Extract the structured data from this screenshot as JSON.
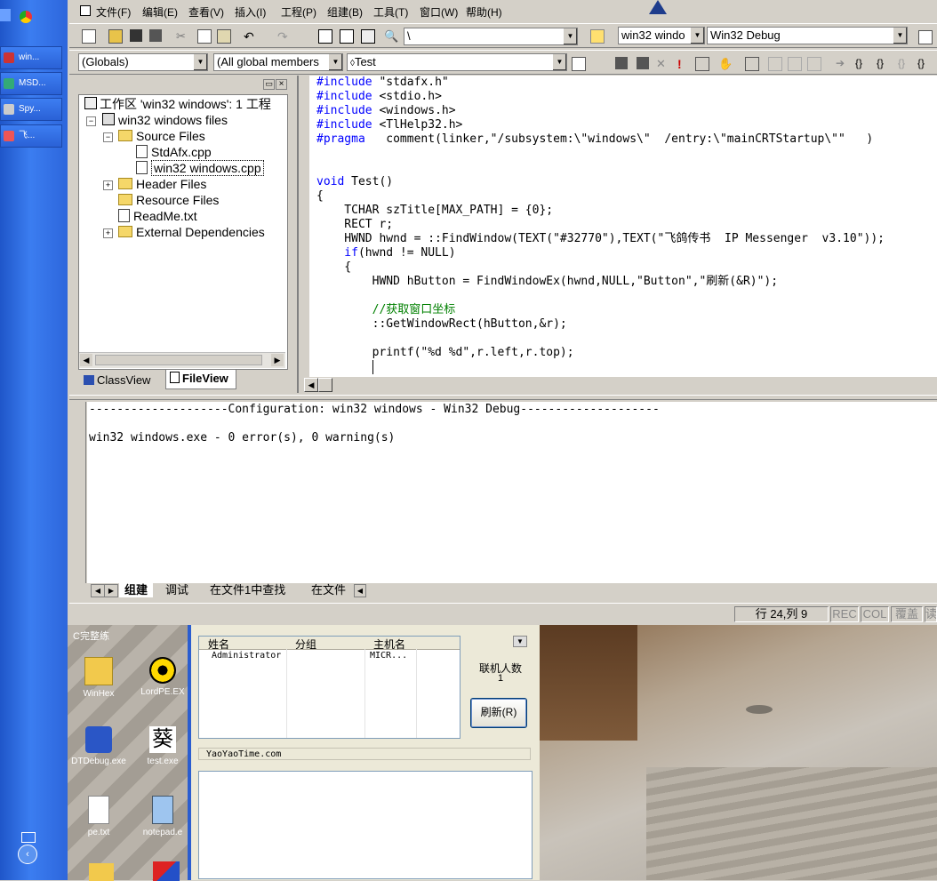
{
  "taskbar": {
    "items": [
      {
        "label": "win..."
      },
      {
        "label": "MSD..."
      },
      {
        "label": "Spy..."
      },
      {
        "label": "飞..."
      }
    ]
  },
  "menu": [
    "文件(F)",
    "编辑(E)",
    "查看(V)",
    "插入(I)",
    "工程(P)",
    "组建(B)",
    "工具(T)",
    "窗口(W)",
    "帮助(H)"
  ],
  "toolbar": {
    "find_value": "\\",
    "project_combo": "win32 windo",
    "config_combo": "Win32 Debug",
    "scope_combo": "(Globals)",
    "members_combo": "(All global members",
    "function_combo": "Test"
  },
  "workspace": {
    "title": "工作区 'win32 windows': 1 工程",
    "project": "win32 windows files",
    "source_folder": "Source Files",
    "file1": "StdAfx.cpp",
    "file2": "win32 windows.cpp",
    "header_folder": "Header Files",
    "resource_folder": "Resource Files",
    "readme": "ReadMe.txt",
    "external": "External Dependencies",
    "tab_classview": "ClassView",
    "tab_fileview": "FileView"
  },
  "code": [
    {
      "a": "#include",
      "b": " \"stdafx.h\""
    },
    {
      "a": "#include",
      "b": " <stdio.h>"
    },
    {
      "a": "#include",
      "b": " <windows.h>"
    },
    {
      "a": "#include",
      "b": " <TlHelp32.h>"
    },
    {
      "a": "#pragma",
      "b": "   comment(linker,\"/subsystem:\\\"windows\\\"  /entry:\\\"mainCRTStartup\\\"\"   )"
    },
    {
      "a": "",
      "b": ""
    },
    {
      "a": "",
      "b": ""
    },
    {
      "a": "void",
      "b": " Test()"
    },
    {
      "a": "",
      "b": "{"
    },
    {
      "a": "",
      "b": "    TCHAR szTitle[MAX_PATH] = {0};"
    },
    {
      "a": "",
      "b": "    RECT r;"
    },
    {
      "a": "",
      "b": "    HWND hwnd = ::FindWindow(TEXT(\"#32770\"),TEXT(\"飞鸽传书  IP Messenger  v3.10\"));"
    },
    {
      "a": "    if",
      "b": "(hwnd != NULL)"
    },
    {
      "a": "",
      "b": "    {"
    },
    {
      "a": "",
      "b": "        HWND hButton = FindWindowEx(hwnd,NULL,\"Button\",\"刷新(&R)\");"
    },
    {
      "a": "",
      "b": ""
    },
    {
      "a": "",
      "b": "",
      "c": "        //获取窗口坐标"
    },
    {
      "a": "",
      "b": "        ::GetWindowRect(hButton,&r);"
    },
    {
      "a": "",
      "b": ""
    },
    {
      "a": "",
      "b": "        printf(\"%d %d\",r.left,r.top);"
    }
  ],
  "output": {
    "line1": "--------------------Configuration: win32 windows - Win32 Debug--------------------",
    "line2": "win32 windows.exe - 0 error(s), 0 warning(s)",
    "tabs": [
      "组建",
      "调试",
      "在文件1中查找",
      "在文件"
    ]
  },
  "status": {
    "position": "行 24,列 9",
    "rec": "REC",
    "col": "COL",
    "ovr": "覆盖",
    "read": "读"
  },
  "desktop": {
    "icons": [
      "WinHex",
      "LordPE.EX",
      "DTDebug.exe",
      "test.exe",
      "pe.txt",
      "notepad.e"
    ],
    "top_text": "C完整练"
  },
  "messenger": {
    "columns": [
      "姓名",
      "分组",
      "主机名"
    ],
    "row": [
      "Administrator",
      "",
      "MICR..."
    ],
    "online_label": "联机人数",
    "online_count": "1",
    "refresh_button": "刷新(R)",
    "message_header": "YaoYaoTime.com"
  }
}
